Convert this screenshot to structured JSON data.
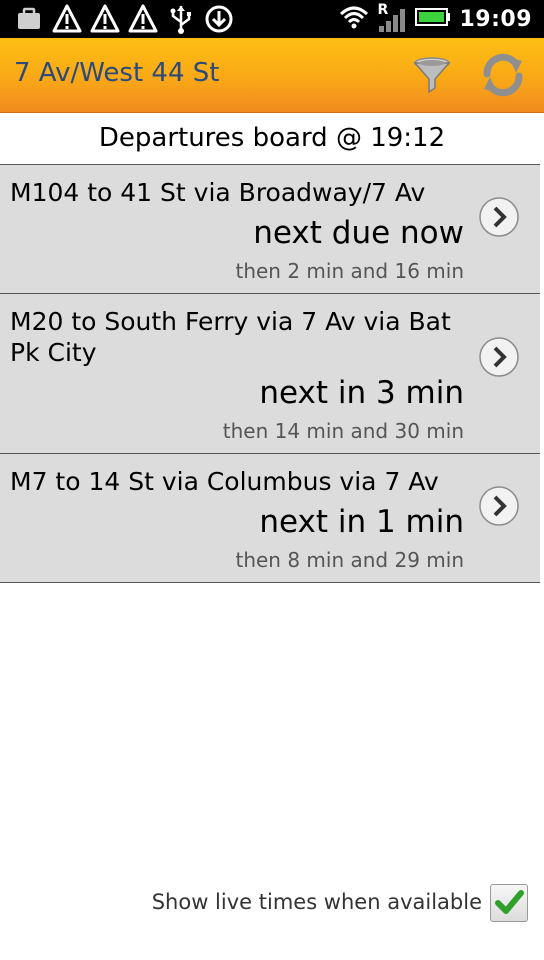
{
  "status_bar": {
    "time": "19:09",
    "left_icons": [
      "briefcase-icon",
      "warning-icon",
      "warning-icon",
      "warning-icon",
      "usb-icon",
      "sync-icon"
    ],
    "right_icons": [
      "wifi-icon",
      "signal-roaming-icon",
      "battery-icon"
    ],
    "roaming_letter": "R"
  },
  "title_bar": {
    "title": "7 Av/West 44 St",
    "colors": {
      "gradient_top": "#fdbf12",
      "gradient_bottom": "#f18a1f",
      "title_text": "#2b4a7a"
    }
  },
  "board": {
    "header": "Departures board @ 19:12",
    "rows": [
      {
        "route": "M104 to 41 St via Broadway/7 Av",
        "next": "next due now",
        "then": "then 2 min and 16 min"
      },
      {
        "route": "M20 to South Ferry via 7 Av via Bat Pk City",
        "next": "next in 3 min",
        "then": "then 14 min and 30 min"
      },
      {
        "route": "M7 to 14 St via Columbus via 7 Av",
        "next": "next in 1 min",
        "then": "then 8 min and 29 min"
      }
    ]
  },
  "footer": {
    "live_times_label": "Show live times when available",
    "live_times_checked": true
  }
}
